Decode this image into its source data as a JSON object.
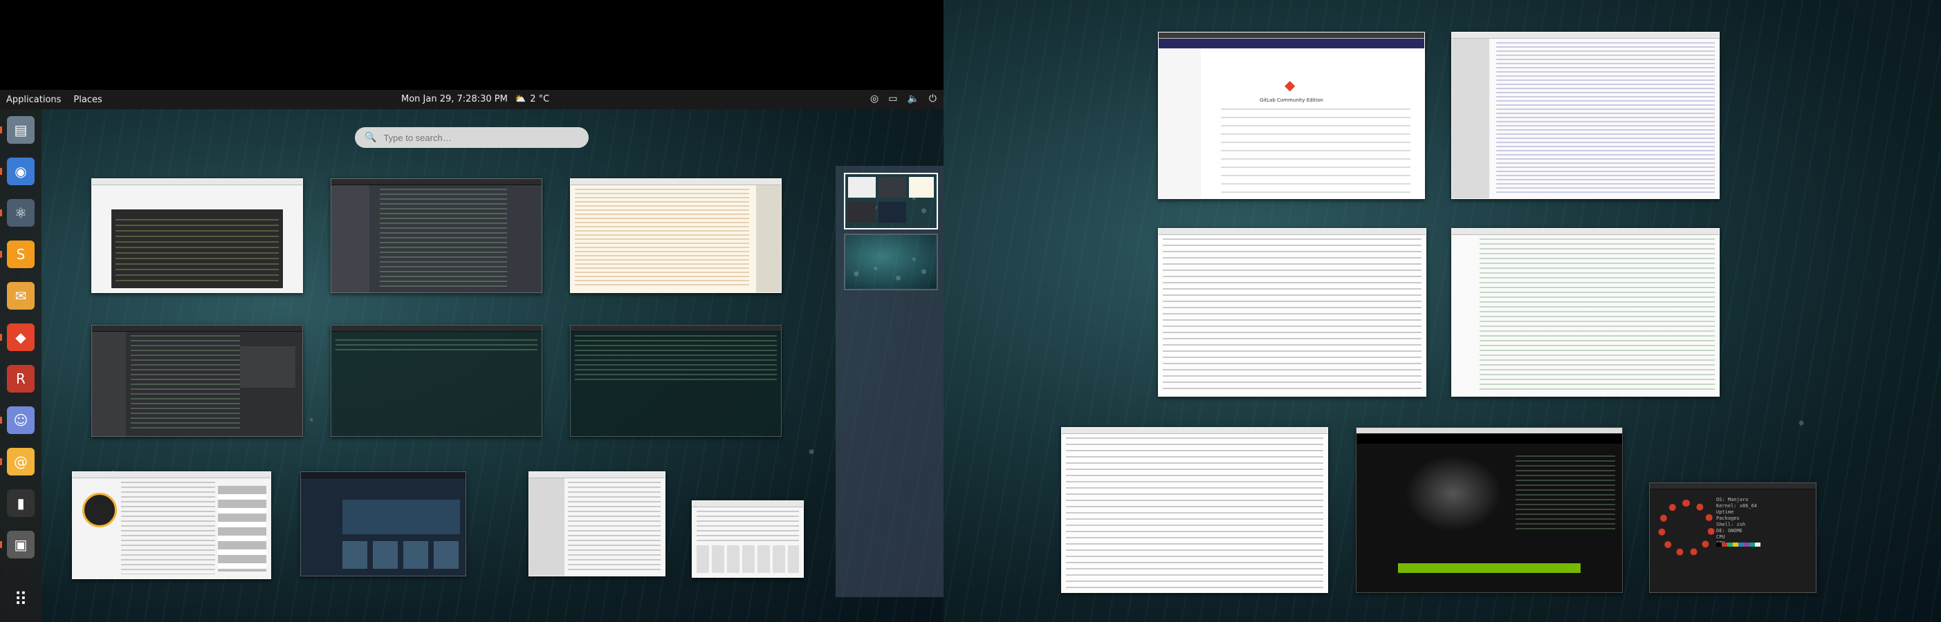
{
  "topbar": {
    "applications": "Applications",
    "places": "Places",
    "clock": "Mon Jan 29,  7:28:30 PM",
    "weather_icon": "cloud-sun-icon",
    "temperature": "2 °C",
    "tray_icons": [
      "accessibility-icon",
      "display-icon",
      "volume-icon",
      "power-icon"
    ]
  },
  "search": {
    "placeholder": "Type to search…"
  },
  "dash": {
    "apps": [
      {
        "name": "files",
        "icon": "▤",
        "color": "#6b7d8c",
        "running": true
      },
      {
        "name": "chromium",
        "icon": "◉",
        "color": "#3a7bd5",
        "running": true
      },
      {
        "name": "atom",
        "icon": "⚛",
        "color": "#4b5d6e",
        "running": true
      },
      {
        "name": "sublime-text",
        "icon": "S",
        "color": "#f29b1d",
        "running": true
      },
      {
        "name": "postman",
        "icon": "✉",
        "color": "#e8a23a",
        "running": false
      },
      {
        "name": "git",
        "icon": "◆",
        "color": "#e24329",
        "running": true
      },
      {
        "name": "redshift",
        "icon": "R",
        "color": "#c0392b",
        "running": false
      },
      {
        "name": "discord",
        "icon": "☺",
        "color": "#7289da",
        "running": true
      },
      {
        "name": "mail",
        "icon": "@",
        "color": "#f3b23a",
        "running": true
      },
      {
        "name": "terminal",
        "icon": "▮",
        "color": "#333333",
        "running": false
      },
      {
        "name": "screenshot",
        "icon": "▣",
        "color": "#5a5a5a",
        "running": true
      }
    ],
    "show_apps_icon": "grid-icon"
  },
  "gitlab": {
    "title": "GitLab Community Edition"
  },
  "colors": {
    "accent": "#e45a2b",
    "workspace_border": "#ffffff"
  }
}
